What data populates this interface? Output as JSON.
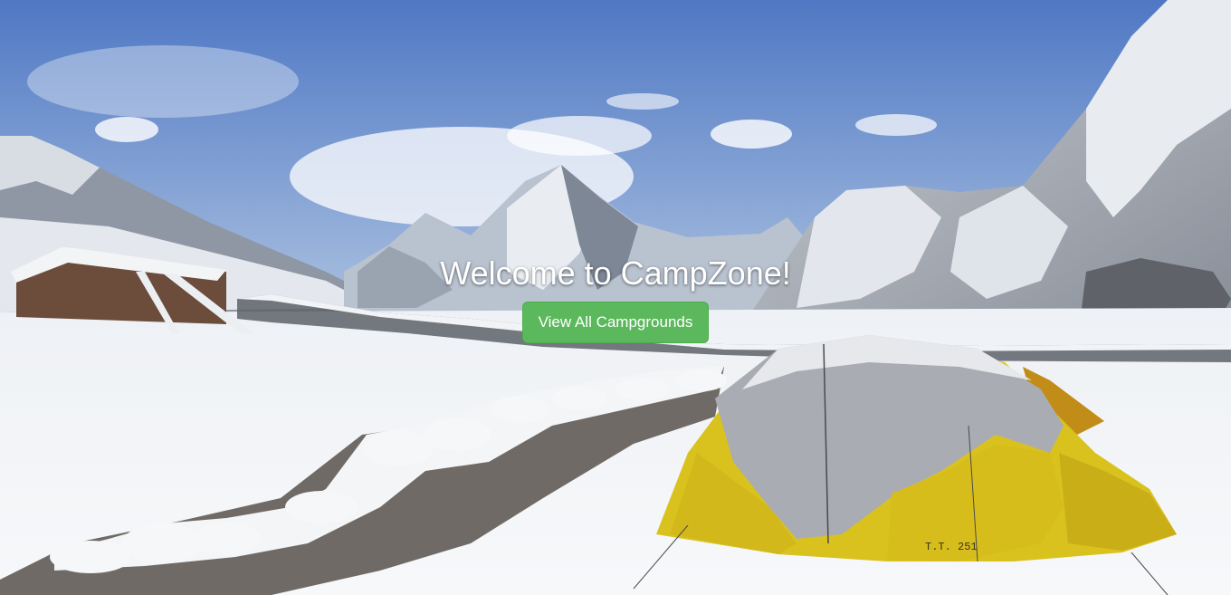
{
  "hero": {
    "title": "Welcome to CampZone!",
    "cta_label": "View All Campgrounds",
    "tent_tag": "T.T. 251",
    "background": "snowy-mountain-campsite-photo"
  },
  "colors": {
    "button": "#5cb85c",
    "button_border": "#4cae4c",
    "title_text": "#ffffff",
    "tent_fabric": "#d9c21e"
  }
}
